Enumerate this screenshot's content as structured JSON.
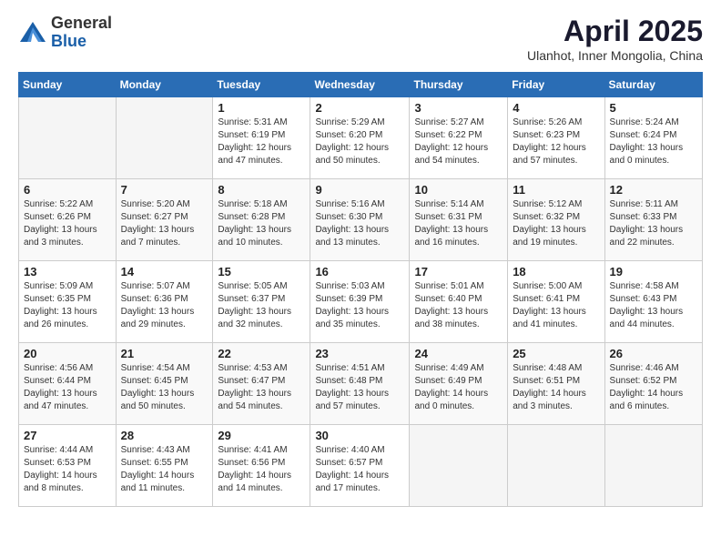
{
  "header": {
    "logo_general": "General",
    "logo_blue": "Blue",
    "month_title": "April 2025",
    "subtitle": "Ulanhot, Inner Mongolia, China"
  },
  "days_of_week": [
    "Sunday",
    "Monday",
    "Tuesday",
    "Wednesday",
    "Thursday",
    "Friday",
    "Saturday"
  ],
  "weeks": [
    [
      {
        "day": "",
        "info": ""
      },
      {
        "day": "",
        "info": ""
      },
      {
        "day": "1",
        "info": "Sunrise: 5:31 AM\nSunset: 6:19 PM\nDaylight: 12 hours and 47 minutes."
      },
      {
        "day": "2",
        "info": "Sunrise: 5:29 AM\nSunset: 6:20 PM\nDaylight: 12 hours and 50 minutes."
      },
      {
        "day": "3",
        "info": "Sunrise: 5:27 AM\nSunset: 6:22 PM\nDaylight: 12 hours and 54 minutes."
      },
      {
        "day": "4",
        "info": "Sunrise: 5:26 AM\nSunset: 6:23 PM\nDaylight: 12 hours and 57 minutes."
      },
      {
        "day": "5",
        "info": "Sunrise: 5:24 AM\nSunset: 6:24 PM\nDaylight: 13 hours and 0 minutes."
      }
    ],
    [
      {
        "day": "6",
        "info": "Sunrise: 5:22 AM\nSunset: 6:26 PM\nDaylight: 13 hours and 3 minutes."
      },
      {
        "day": "7",
        "info": "Sunrise: 5:20 AM\nSunset: 6:27 PM\nDaylight: 13 hours and 7 minutes."
      },
      {
        "day": "8",
        "info": "Sunrise: 5:18 AM\nSunset: 6:28 PM\nDaylight: 13 hours and 10 minutes."
      },
      {
        "day": "9",
        "info": "Sunrise: 5:16 AM\nSunset: 6:30 PM\nDaylight: 13 hours and 13 minutes."
      },
      {
        "day": "10",
        "info": "Sunrise: 5:14 AM\nSunset: 6:31 PM\nDaylight: 13 hours and 16 minutes."
      },
      {
        "day": "11",
        "info": "Sunrise: 5:12 AM\nSunset: 6:32 PM\nDaylight: 13 hours and 19 minutes."
      },
      {
        "day": "12",
        "info": "Sunrise: 5:11 AM\nSunset: 6:33 PM\nDaylight: 13 hours and 22 minutes."
      }
    ],
    [
      {
        "day": "13",
        "info": "Sunrise: 5:09 AM\nSunset: 6:35 PM\nDaylight: 13 hours and 26 minutes."
      },
      {
        "day": "14",
        "info": "Sunrise: 5:07 AM\nSunset: 6:36 PM\nDaylight: 13 hours and 29 minutes."
      },
      {
        "day": "15",
        "info": "Sunrise: 5:05 AM\nSunset: 6:37 PM\nDaylight: 13 hours and 32 minutes."
      },
      {
        "day": "16",
        "info": "Sunrise: 5:03 AM\nSunset: 6:39 PM\nDaylight: 13 hours and 35 minutes."
      },
      {
        "day": "17",
        "info": "Sunrise: 5:01 AM\nSunset: 6:40 PM\nDaylight: 13 hours and 38 minutes."
      },
      {
        "day": "18",
        "info": "Sunrise: 5:00 AM\nSunset: 6:41 PM\nDaylight: 13 hours and 41 minutes."
      },
      {
        "day": "19",
        "info": "Sunrise: 4:58 AM\nSunset: 6:43 PM\nDaylight: 13 hours and 44 minutes."
      }
    ],
    [
      {
        "day": "20",
        "info": "Sunrise: 4:56 AM\nSunset: 6:44 PM\nDaylight: 13 hours and 47 minutes."
      },
      {
        "day": "21",
        "info": "Sunrise: 4:54 AM\nSunset: 6:45 PM\nDaylight: 13 hours and 50 minutes."
      },
      {
        "day": "22",
        "info": "Sunrise: 4:53 AM\nSunset: 6:47 PM\nDaylight: 13 hours and 54 minutes."
      },
      {
        "day": "23",
        "info": "Sunrise: 4:51 AM\nSunset: 6:48 PM\nDaylight: 13 hours and 57 minutes."
      },
      {
        "day": "24",
        "info": "Sunrise: 4:49 AM\nSunset: 6:49 PM\nDaylight: 14 hours and 0 minutes."
      },
      {
        "day": "25",
        "info": "Sunrise: 4:48 AM\nSunset: 6:51 PM\nDaylight: 14 hours and 3 minutes."
      },
      {
        "day": "26",
        "info": "Sunrise: 4:46 AM\nSunset: 6:52 PM\nDaylight: 14 hours and 6 minutes."
      }
    ],
    [
      {
        "day": "27",
        "info": "Sunrise: 4:44 AM\nSunset: 6:53 PM\nDaylight: 14 hours and 8 minutes."
      },
      {
        "day": "28",
        "info": "Sunrise: 4:43 AM\nSunset: 6:55 PM\nDaylight: 14 hours and 11 minutes."
      },
      {
        "day": "29",
        "info": "Sunrise: 4:41 AM\nSunset: 6:56 PM\nDaylight: 14 hours and 14 minutes."
      },
      {
        "day": "30",
        "info": "Sunrise: 4:40 AM\nSunset: 6:57 PM\nDaylight: 14 hours and 17 minutes."
      },
      {
        "day": "",
        "info": ""
      },
      {
        "day": "",
        "info": ""
      },
      {
        "day": "",
        "info": ""
      }
    ]
  ]
}
